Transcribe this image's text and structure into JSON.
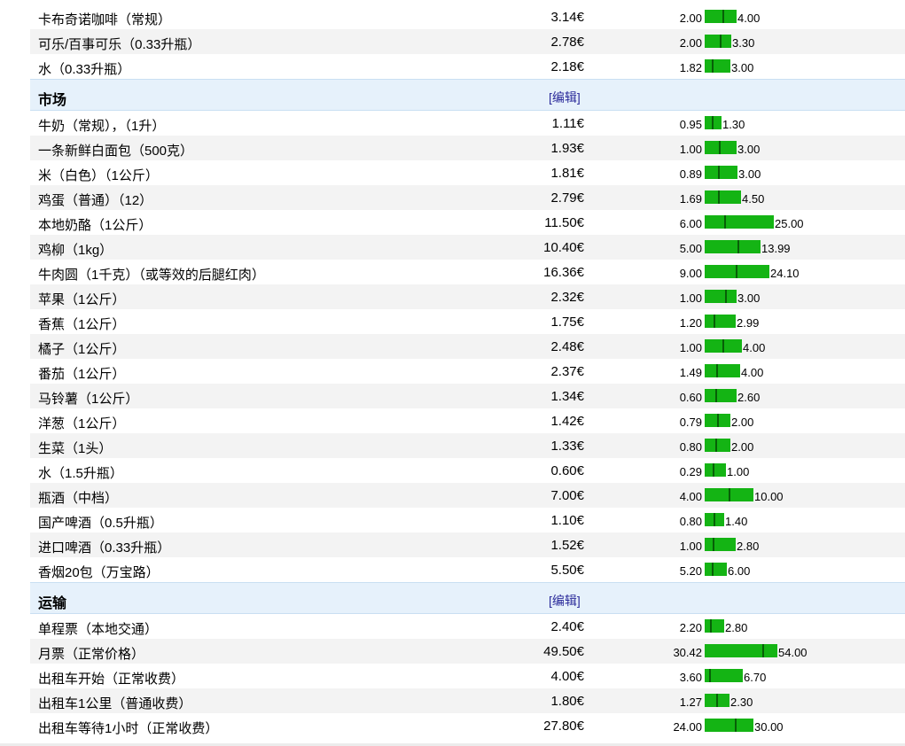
{
  "cur": "€",
  "edit_label": "[编辑]",
  "top_items": [
    {
      "name": "卡布奇诺咖啡（常规）",
      "price": "3.14€",
      "min": "2.00",
      "max": "4.00",
      "lo": 2.0,
      "hi": 4.0,
      "avg": 3.14
    },
    {
      "name": "可乐/百事可乐（0.33升瓶）",
      "price": "2.78€",
      "min": "2.00",
      "max": "3.30",
      "lo": 2.0,
      "hi": 3.3,
      "avg": 2.78
    },
    {
      "name": "水（0.33升瓶）",
      "price": "2.18€",
      "min": "1.82",
      "max": "3.00",
      "lo": 1.82,
      "hi": 3.0,
      "avg": 2.18
    }
  ],
  "sections": [
    {
      "title": "市场",
      "items": [
        {
          "name": "牛奶（常规），（1升）",
          "price": "1.11€",
          "min": "0.95",
          "max": "1.30",
          "lo": 0.95,
          "hi": 1.3,
          "avg": 1.11
        },
        {
          "name": "一条新鲜白面包（500克）",
          "price": "1.93€",
          "min": "1.00",
          "max": "3.00",
          "lo": 1.0,
          "hi": 3.0,
          "avg": 1.93
        },
        {
          "name": "米（白色）（1公斤）",
          "price": "1.81€",
          "min": "0.89",
          "max": "3.00",
          "lo": 0.89,
          "hi": 3.0,
          "avg": 1.81
        },
        {
          "name": "鸡蛋（普通）（12）",
          "price": "2.79€",
          "min": "1.69",
          "max": "4.50",
          "lo": 1.69,
          "hi": 4.5,
          "avg": 2.79
        },
        {
          "name": "本地奶酪（1公斤）",
          "price": "11.50€",
          "min": "6.00",
          "max": "25.00",
          "lo": 6.0,
          "hi": 25.0,
          "avg": 11.5
        },
        {
          "name": "鸡柳（1kg）",
          "price": "10.40€",
          "min": "5.00",
          "max": "13.99",
          "lo": 5.0,
          "hi": 13.99,
          "avg": 10.4
        },
        {
          "name": "牛肉圆（1千克）（或等效的后腿红肉）",
          "price": "16.36€",
          "min": "9.00",
          "max": "24.10",
          "lo": 9.0,
          "hi": 24.1,
          "avg": 16.36
        },
        {
          "name": "苹果（1公斤）",
          "price": "2.32€",
          "min": "1.00",
          "max": "3.00",
          "lo": 1.0,
          "hi": 3.0,
          "avg": 2.32
        },
        {
          "name": "香蕉（1公斤）",
          "price": "1.75€",
          "min": "1.20",
          "max": "2.99",
          "lo": 1.2,
          "hi": 2.99,
          "avg": 1.75
        },
        {
          "name": "橘子（1公斤）",
          "price": "2.48€",
          "min": "1.00",
          "max": "4.00",
          "lo": 1.0,
          "hi": 4.0,
          "avg": 2.48
        },
        {
          "name": "番茄（1公斤）",
          "price": "2.37€",
          "min": "1.49",
          "max": "4.00",
          "lo": 1.49,
          "hi": 4.0,
          "avg": 2.37
        },
        {
          "name": "马铃薯（1公斤）",
          "price": "1.34€",
          "min": "0.60",
          "max": "2.60",
          "lo": 0.6,
          "hi": 2.6,
          "avg": 1.34
        },
        {
          "name": "洋葱（1公斤）",
          "price": "1.42€",
          "min": "0.79",
          "max": "2.00",
          "lo": 0.79,
          "hi": 2.0,
          "avg": 1.42
        },
        {
          "name": "生菜（1头）",
          "price": "1.33€",
          "min": "0.80",
          "max": "2.00",
          "lo": 0.8,
          "hi": 2.0,
          "avg": 1.33
        },
        {
          "name": "水（1.5升瓶）",
          "price": "0.60€",
          "min": "0.29",
          "max": "1.00",
          "lo": 0.29,
          "hi": 1.0,
          "avg": 0.6
        },
        {
          "name": "瓶酒（中档）",
          "price": "7.00€",
          "min": "4.00",
          "max": "10.00",
          "lo": 4.0,
          "hi": 10.0,
          "avg": 7.0
        },
        {
          "name": "国产啤酒（0.5升瓶）",
          "price": "1.10€",
          "min": "0.80",
          "max": "1.40",
          "lo": 0.8,
          "hi": 1.4,
          "avg": 1.1
        },
        {
          "name": "进口啤酒（0.33升瓶）",
          "price": "1.52€",
          "min": "1.00",
          "max": "2.80",
          "lo": 1.0,
          "hi": 2.8,
          "avg": 1.52
        },
        {
          "name": "香烟20包（万宝路）",
          "price": "5.50€",
          "min": "5.20",
          "max": "6.00",
          "lo": 5.2,
          "hi": 6.0,
          "avg": 5.5
        }
      ]
    },
    {
      "title": "运输",
      "items": [
        {
          "name": "单程票（本地交通）",
          "price": "2.40€",
          "min": "2.20",
          "max": "2.80",
          "lo": 2.2,
          "hi": 2.8,
          "avg": 2.4
        },
        {
          "name": "月票（正常价格）",
          "price": "49.50€",
          "min": "30.42",
          "max": "54.00",
          "lo": 30.42,
          "hi": 54.0,
          "avg": 49.5
        },
        {
          "name": "出租车开始（正常收费）",
          "price": "4.00€",
          "min": "3.60",
          "max": "6.70",
          "lo": 3.6,
          "hi": 6.7,
          "avg": 4.0
        },
        {
          "name": "出租车1公里（普通收费）",
          "price": "1.80€",
          "min": "1.27",
          "max": "2.30",
          "lo": 1.27,
          "hi": 2.3,
          "avg": 1.8
        },
        {
          "name": "出租车等待1小时（正常收费）",
          "price": "27.80€",
          "min": "24.00",
          "max": "30.00",
          "lo": 24.0,
          "hi": 30.0,
          "avg": 27.8
        }
      ]
    }
  ]
}
